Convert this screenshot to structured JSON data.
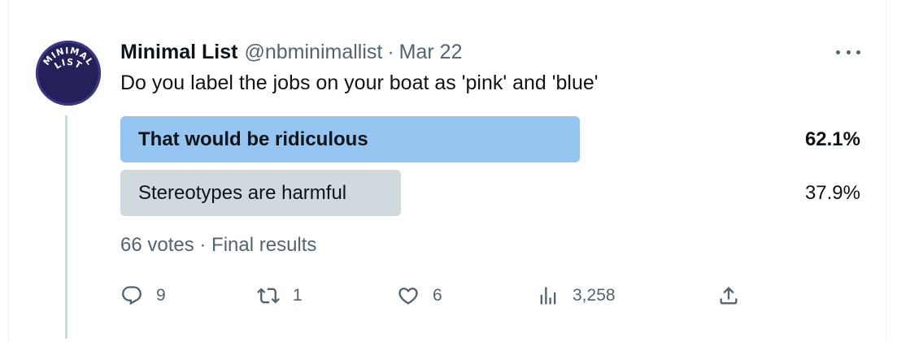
{
  "avatar": {
    "logo_text_line1": "MINIMAL",
    "logo_text_line2": "LIST"
  },
  "tweet": {
    "author_name": "Minimal List",
    "handle": "@nbminimallist",
    "separator": "·",
    "date": "Mar 22",
    "text": "Do you label the jobs on your boat as 'pink' and 'blue'"
  },
  "poll": {
    "options": [
      {
        "label": "That would be ridiculous",
        "percent": "62.1%",
        "share": 0.621,
        "winner": true,
        "color": "#95c5f1"
      },
      {
        "label": "Stereotypes are harmful",
        "percent": "37.9%",
        "share": 0.379,
        "winner": false,
        "color": "#cfd9de"
      }
    ],
    "summary": "66 votes · Final results"
  },
  "actions": {
    "replies": "9",
    "reposts": "1",
    "likes": "6",
    "views": "3,258"
  },
  "icons": {
    "more": "more-horizontal-icon",
    "reply": "reply-icon",
    "repost": "repost-icon",
    "like": "heart-icon",
    "views": "views-icon",
    "share": "share-icon"
  },
  "colors": {
    "text_primary": "#0f1419",
    "text_secondary": "#536471",
    "poll_winner": "#95c5f1",
    "poll_other": "#cfd9de"
  }
}
